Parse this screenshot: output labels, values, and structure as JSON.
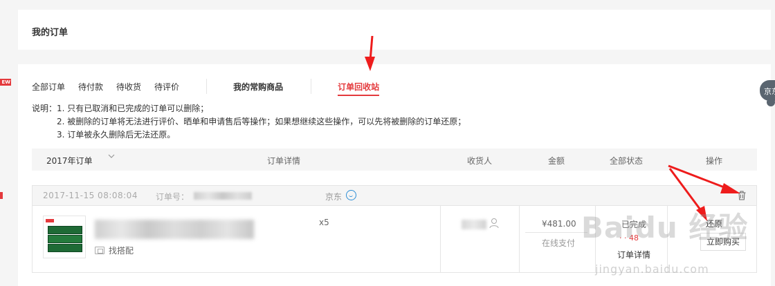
{
  "left": {
    "badge": "EW"
  },
  "header": {
    "title": "我的订单"
  },
  "tabs": {
    "all": "全部订单",
    "pending_payment": "待付款",
    "pending_receipt": "待收货",
    "pending_review": "待评价",
    "frequent": "我的常购商品",
    "recycle": "订单回收站"
  },
  "notes": {
    "line1": "说明：1. 只有已取消和已完成的订单可以删除；",
    "line2": "2. 被删除的订单将无法进行评价、晒单和申请售后等操作；如果想继续这些操作，可以先将被删除的订单还原；",
    "line3": "3. 订单被永久删除后无法还原。"
  },
  "table_header": {
    "year": "2017年订单",
    "details": "订单详情",
    "receiver": "收货人",
    "amount": "金额",
    "status": "全部状态",
    "action": "操作"
  },
  "order": {
    "date": "2017-11-15 08:08:04",
    "order_no_label": "订单号：",
    "shop": "京东",
    "bundle": "找搭配",
    "qty": "x5",
    "amount": "¥481.00",
    "payment": "在线支付",
    "status": "已完成",
    "status_note": "· · 48",
    "status_detail": "订单详情",
    "restore": "还原",
    "buy_again": "立即购买"
  },
  "right_widget": {
    "label": "京东"
  },
  "watermark": {
    "main": "Baidu 经验",
    "sub": "jingyan.baidu.com"
  },
  "colors": {
    "accent": "#e4393c",
    "link_blue": "#2c8ed6"
  },
  "icons": [
    "chevron-down-icon",
    "chat-icon",
    "trash-icon",
    "person-icon",
    "bundle-icon",
    "arrow-icon"
  ]
}
